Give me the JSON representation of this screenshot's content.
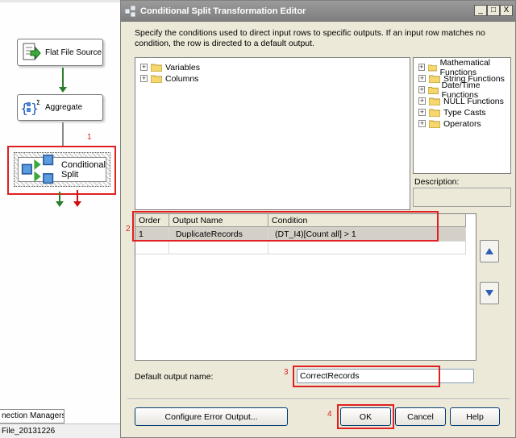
{
  "designer": {
    "tasks": [
      {
        "label": "Flat File Source"
      },
      {
        "label": "Aggregate"
      },
      {
        "label": "Conditional Split"
      }
    ],
    "badges": [
      "1",
      "2",
      "3",
      "4"
    ],
    "connection_tab": "nection Managers",
    "connection_item": "File_20131226"
  },
  "dialog": {
    "title": "Conditional Split Transformation Editor",
    "window_controls": {
      "minimize": "_",
      "maximize": "□",
      "close": "X"
    },
    "instructions": "Specify the conditions used to direct input rows to specific outputs. If an input row matches no condition, the row is directed to a default output.",
    "input_tree": [
      {
        "label": "Variables"
      },
      {
        "label": "Columns"
      }
    ],
    "function_tree": [
      {
        "label": "Mathematical Functions"
      },
      {
        "label": "String Functions"
      },
      {
        "label": "Date/Time Functions"
      },
      {
        "label": "NULL Functions"
      },
      {
        "label": "Type Casts"
      },
      {
        "label": "Operators"
      }
    ],
    "description_label": "Description:",
    "grid": {
      "headers": [
        "Order",
        "Output Name",
        "Condition"
      ],
      "rows": [
        {
          "order": "1",
          "output_name": "DuplicateRecords",
          "condition": "(DT_I4)[Count all] > 1"
        }
      ]
    },
    "default_output_label": "Default output name:",
    "default_output_value": "CorrectRecords",
    "buttons": {
      "configure_error": "Configure Error Output...",
      "ok": "OK",
      "cancel": "Cancel",
      "help": "Help"
    },
    "colors": {
      "annotation_red": "#e02020",
      "success_path": "#2a7d2a",
      "error_path": "#d01010"
    }
  }
}
